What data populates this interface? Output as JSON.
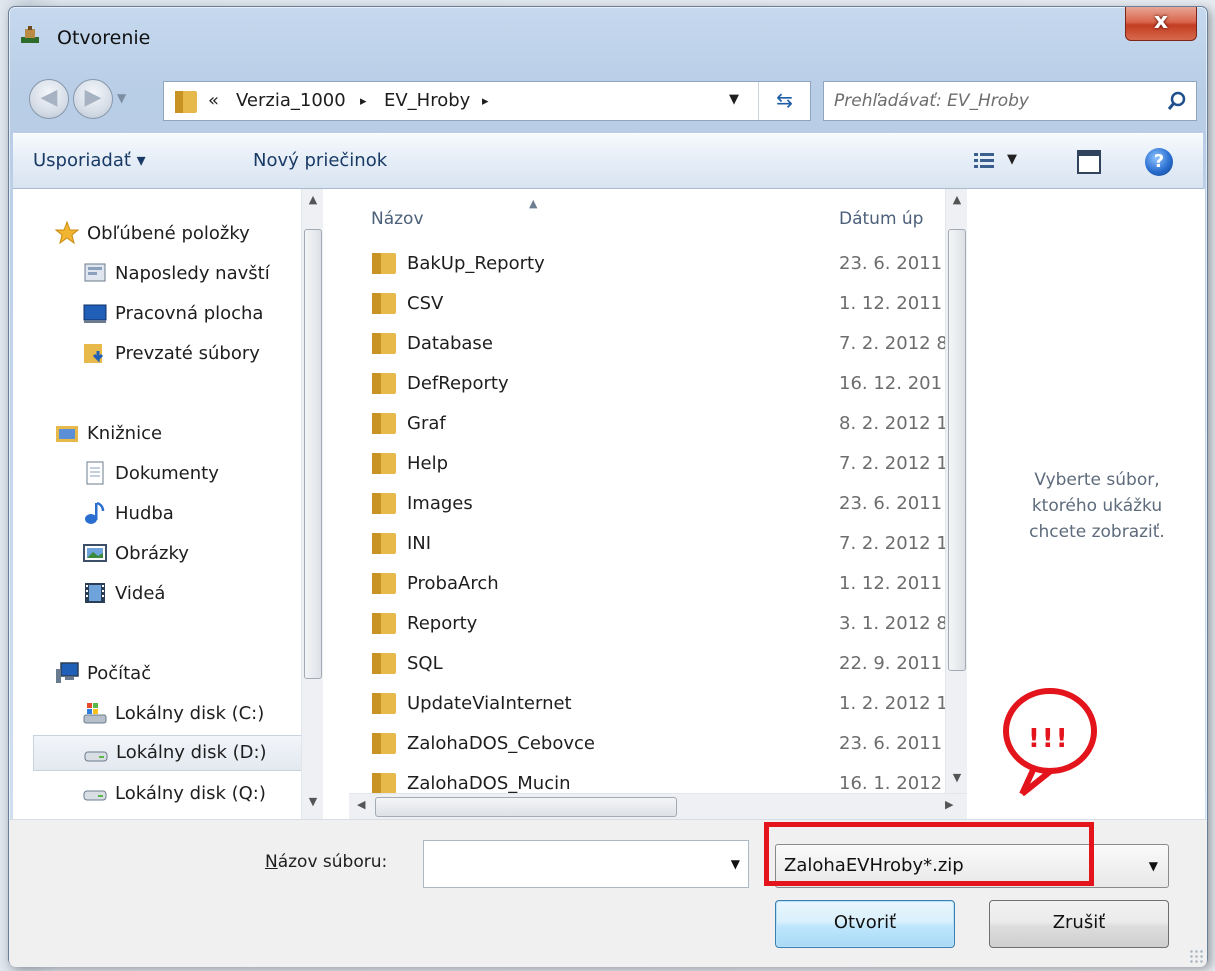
{
  "window": {
    "title": "Otvorenie",
    "close_label": "x"
  },
  "address": {
    "prefix": "«",
    "crumbs": [
      "Verzia_1000",
      "EV_Hroby"
    ],
    "separator": "▸"
  },
  "search": {
    "placeholder": "Prehľadávať: EV_Hroby"
  },
  "toolbar": {
    "organize_label": "Usporiadať ▾",
    "new_folder_label": "Nový priečinok"
  },
  "sidebar": {
    "items": [
      {
        "label": "Obľúbené položky",
        "icon": "star-icon"
      },
      {
        "label": "Naposledy navští",
        "icon": "recent-places-icon"
      },
      {
        "label": "Pracovná plocha",
        "icon": "desktop-icon"
      },
      {
        "label": "Prevzaté súbory",
        "icon": "downloads-icon"
      },
      {
        "label": "Knižnice",
        "icon": "libraries-icon"
      },
      {
        "label": "Dokumenty",
        "icon": "documents-icon"
      },
      {
        "label": "Hudba",
        "icon": "music-icon"
      },
      {
        "label": "Obrázky",
        "icon": "pictures-icon"
      },
      {
        "label": "Videá",
        "icon": "videos-icon"
      },
      {
        "label": "Počítač",
        "icon": "computer-icon"
      },
      {
        "label": "Lokálny disk (C:)",
        "icon": "drive-c-icon"
      },
      {
        "label": "Lokálny disk (D:)",
        "icon": "drive-icon",
        "selected": true
      },
      {
        "label": "Lokálny disk (Q:)",
        "icon": "drive-icon"
      }
    ]
  },
  "files": {
    "columns": {
      "name": "Názov",
      "date": "Dátum úp"
    },
    "rows": [
      {
        "name": "BakUp_Reporty",
        "date": "23. 6. 2011"
      },
      {
        "name": "CSV",
        "date": "1. 12. 2011"
      },
      {
        "name": "Database",
        "date": "7. 2. 2012 8"
      },
      {
        "name": "DefReporty",
        "date": "16. 12. 201"
      },
      {
        "name": "Graf",
        "date": "8. 2. 2012 1"
      },
      {
        "name": "Help",
        "date": "7. 2. 2012 1"
      },
      {
        "name": "Images",
        "date": "23. 6. 2011"
      },
      {
        "name": "INI",
        "date": "7. 2. 2012 1"
      },
      {
        "name": "ProbaArch",
        "date": "1. 12. 2011"
      },
      {
        "name": "Reporty",
        "date": "3. 1. 2012 8"
      },
      {
        "name": "SQL",
        "date": "22. 9. 2011"
      },
      {
        "name": "UpdateViaInternet",
        "date": "1. 2. 2012 1"
      },
      {
        "name": "ZalohaDOS_Cebovce",
        "date": "23. 6. 2011"
      },
      {
        "name": "ZalohaDOS_Mucin",
        "date": "16. 1. 2012"
      }
    ]
  },
  "preview": {
    "line1": "Vyberte súbor,",
    "line2": "ktorého ukážku",
    "line3": "chcete zobraziť."
  },
  "bottom": {
    "filename_label_hotkey": "N",
    "filename_label_rest": "ázov súboru:",
    "filename_value": "",
    "filter_value": "ZalohaEVHroby*.zip",
    "open_label": "Otvoriť",
    "cancel_label": "Zrušiť"
  },
  "annotation": {
    "text": "!!!",
    "color": "#e3141c"
  }
}
